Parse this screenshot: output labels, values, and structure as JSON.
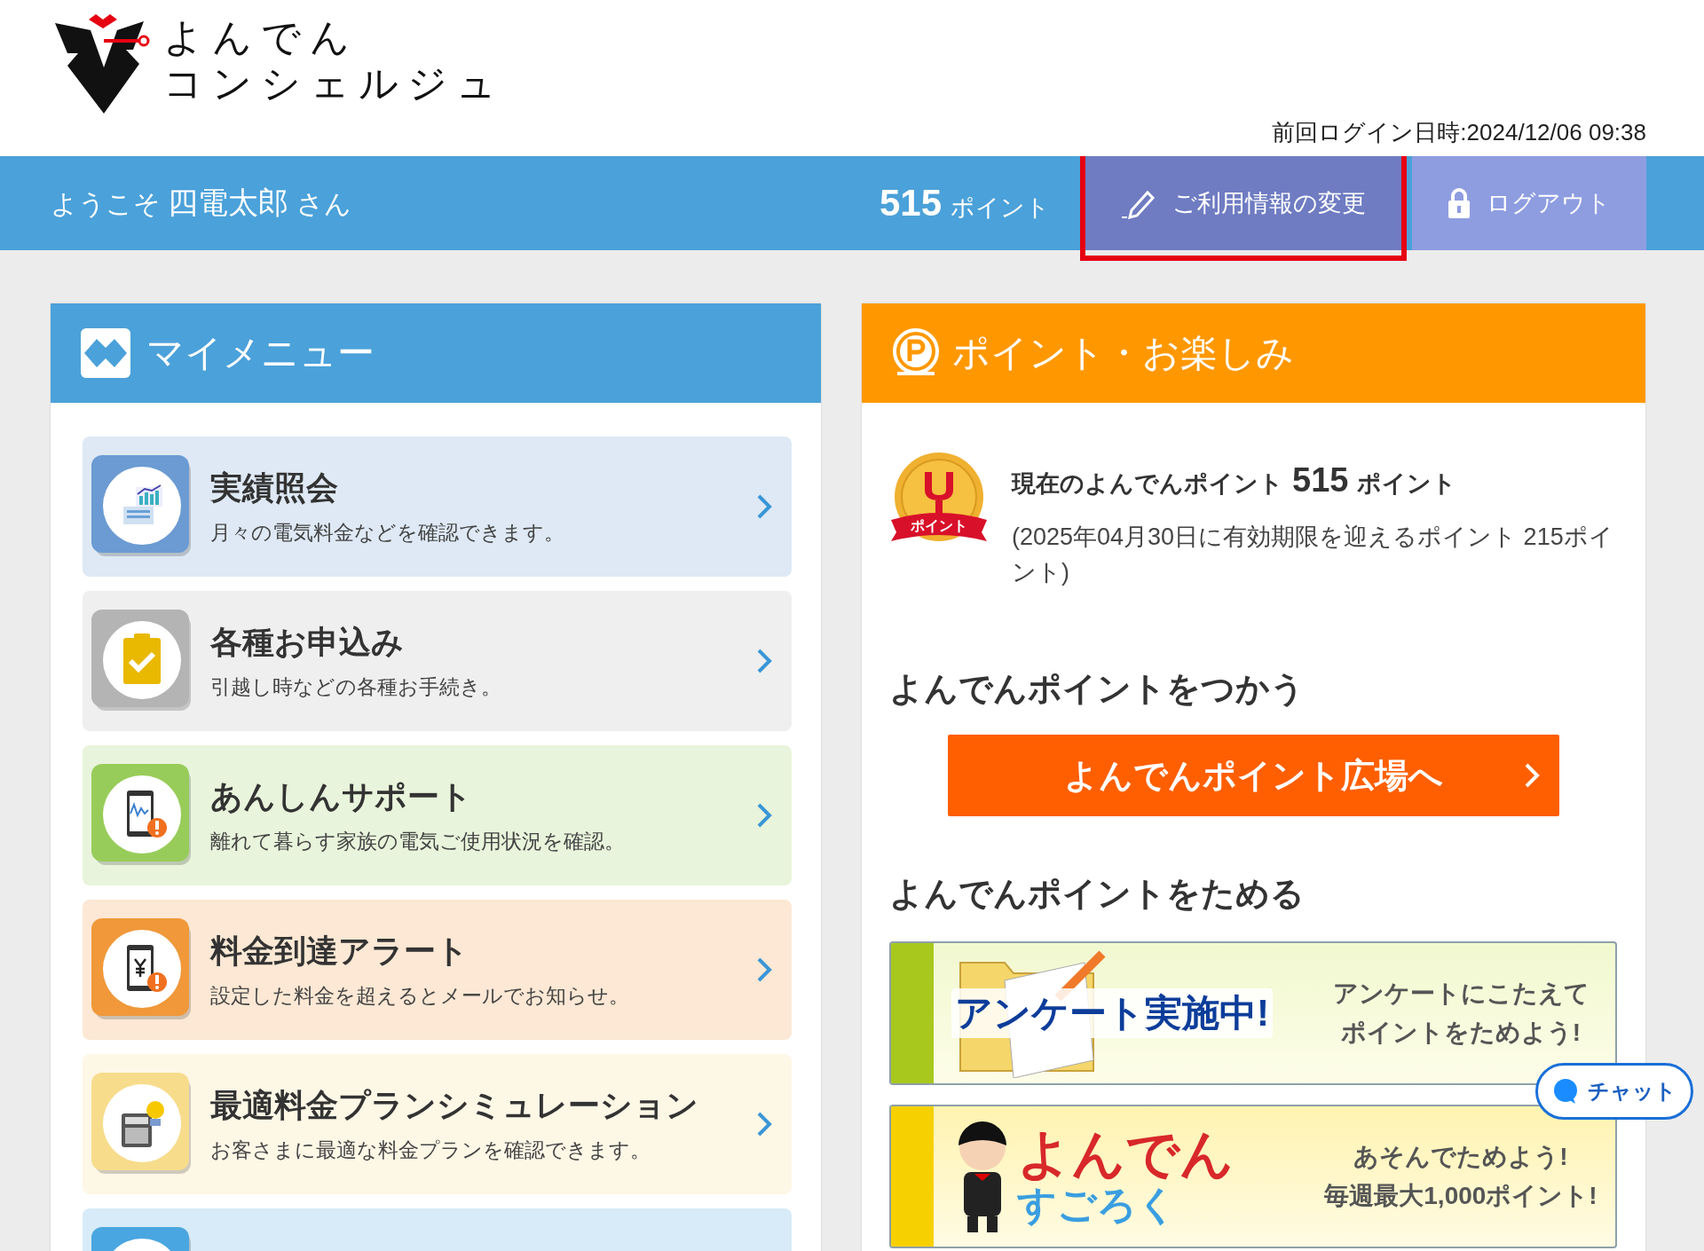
{
  "logo": {
    "line1": "よんでん",
    "line2": "コンシェルジュ"
  },
  "last_login": "前回ログイン日時:2024/12/06 09:38",
  "user_bar": {
    "greeting": "ようこそ",
    "name": "四電太郎",
    "suffix": "さん",
    "points": "515",
    "points_unit": "ポイント",
    "buttons": [
      {
        "kind": "edit",
        "label": "ご利用情報の変更",
        "highlighted": true
      },
      {
        "kind": "logout",
        "label": "ログアウト",
        "highlighted": false
      }
    ]
  },
  "my_menu": {
    "title": "マイメニュー",
    "items": [
      {
        "kind": "chart",
        "title": "実績照会",
        "description": "月々の電気料金などを確認できます。",
        "color": "#6b9bd2"
      },
      {
        "kind": "clipboard",
        "title": "各種お申込み",
        "description": "引越し時などの各種お手続き。",
        "color": "#b4b4b4"
      },
      {
        "kind": "phone-wave",
        "title": "あんしんサポート",
        "description": "離れて暮らす家族の電気ご使用状況を確認。",
        "color": "#98cc5a"
      },
      {
        "kind": "phone-yen",
        "title": "料金到達アラート",
        "description": "設定した料金を超えるとメールでお知らせ。",
        "color": "#f0983a"
      },
      {
        "kind": "calculator",
        "title": "最適料金プランシミュレーション",
        "description": "お客さまに最適な料金プランを確認できます。",
        "color": "#f7dc8c"
      },
      {
        "kind": "house",
        "color": "#4aa6e0"
      }
    ]
  },
  "points_panel": {
    "title": "ポイント・お楽しみ",
    "current_label": "現在のよんでんポイント",
    "current_points": "515",
    "current_unit": "ポイント",
    "medal_label": "ポイント",
    "expiry_note": "(2025年04月30日に有効期限を迎えるポイント 215ポイント)",
    "use_heading": "よんでんポイントをつかう",
    "use_button": "よんでんポイント広場へ",
    "save_heading": "よんでんポイントをためる",
    "banners": [
      {
        "kind": "survey",
        "headline": "アンケート実施中!",
        "text_lines": [
          "アンケートにこたえて",
          "ポイントをためよう!"
        ],
        "color": "#a8c81e"
      },
      {
        "kind": "sugoroku",
        "headline": "よんでん",
        "subheadline": "すごろく",
        "text_lines": [
          "あそんでためよう!",
          "毎週最大1,000ポイント!"
        ],
        "color": "#f7d000"
      }
    ]
  },
  "chat_button": "チャット"
}
